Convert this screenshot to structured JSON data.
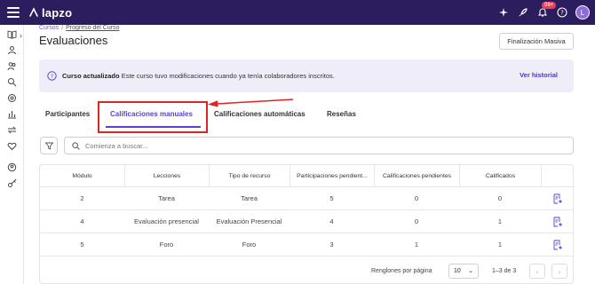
{
  "topbar": {
    "brand": "lapzo",
    "notification_count": "99+",
    "avatar_initial": "L",
    "icons": [
      "menu-icon",
      "sparkle-icon",
      "rocket-icon",
      "bell-icon",
      "help-icon"
    ]
  },
  "sidebar": {
    "icons": [
      "book-icon",
      "user-icon",
      "users-icon",
      "search-icon",
      "target-icon",
      "chart-icon",
      "arrows-icon",
      "heart-icon",
      "group-icon",
      "key-icon"
    ]
  },
  "breadcrumb": {
    "items": [
      "Cursos",
      "Progreso del Curso"
    ],
    "separator": "/"
  },
  "page": {
    "title": "Evaluaciones",
    "final_button": "Finalización Masiva"
  },
  "banner": {
    "bold": "Curso actualizado",
    "text": " Este curso tuvo modificaciones cuando ya tenía colaboradores inscritos.",
    "link": "Ver historial"
  },
  "tabs": [
    {
      "label": "Participantes",
      "active": false
    },
    {
      "label": "Calificaciones manuales",
      "active": true
    },
    {
      "label": "Calificaciones automáticas",
      "active": false
    },
    {
      "label": "Reseñas",
      "active": false
    }
  ],
  "search": {
    "placeholder": "Comienza a buscar..."
  },
  "table": {
    "headers": [
      "Módulo",
      "Lecciones",
      "Tipo de recurso",
      "Participaciones pendient...",
      "Calificaciones pendientes",
      "Calificados",
      ""
    ],
    "rows": [
      [
        "2",
        "Tarea",
        "Tarea",
        "5",
        "0",
        "0"
      ],
      [
        "4",
        "Evaluación presencial",
        "Evaluación Presencial",
        "4",
        "0",
        "1"
      ],
      [
        "5",
        "Foro",
        "Foro",
        "3",
        "1",
        "1"
      ]
    ]
  },
  "pagination": {
    "rows_per_page_label": "Renglones por página",
    "rows_per_page": "10",
    "range": "1–3 de 3"
  },
  "colors": {
    "topbar": "#2b1d5e",
    "accent": "#5a3fd6",
    "highlight": "#e02424",
    "banner": "#efedf7"
  }
}
